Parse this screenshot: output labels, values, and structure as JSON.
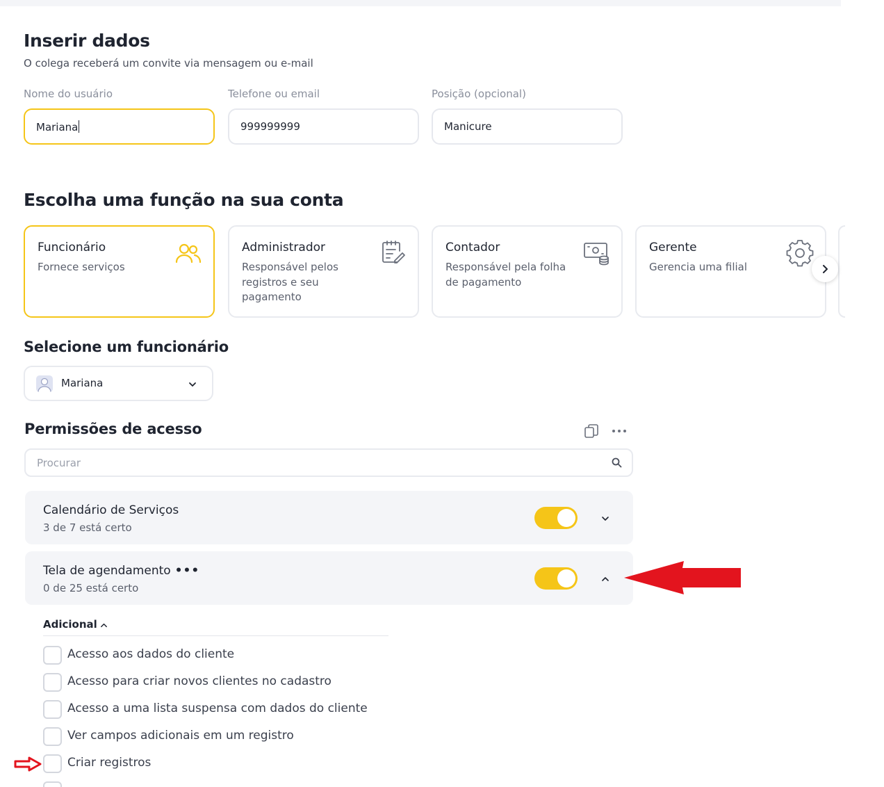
{
  "form": {
    "title": "Inserir dados",
    "subtitle": "O colega receberá um convite via mensagem ou e-mail",
    "fields": [
      {
        "label": "Nome do usuário",
        "value": "Mariana"
      },
      {
        "label": "Telefone ou email",
        "value": "999999999"
      },
      {
        "label": "Posição (opcional)",
        "value": "Manicure"
      }
    ]
  },
  "roles": {
    "title": "Escolha uma função na sua conta",
    "items": [
      {
        "title": "Funcionário",
        "desc": "Fornece serviços",
        "icon": "users-icon"
      },
      {
        "title": "Administrador",
        "desc": "Responsável pelos registros e seu pagamento",
        "icon": "clipboard-edit-icon"
      },
      {
        "title": "Contador",
        "desc": "Responsável pela folha de pagamento",
        "icon": "money-coins-icon"
      },
      {
        "title": "Gerente",
        "desc": "Gerencia uma filial",
        "icon": "gear-icon"
      }
    ]
  },
  "employee": {
    "title": "Selecione um funcionário",
    "selected": "Mariana"
  },
  "permissions": {
    "title": "Permissões de acesso",
    "search_placeholder": "Procurar",
    "sections": [
      {
        "title": "Calendário de Serviços",
        "count": "3 de 7 está certo",
        "enabled": true
      },
      {
        "title": "Tela de agendamento",
        "dots": "•••",
        "count": "0 de 25 está certo",
        "enabled": true
      }
    ],
    "additional": {
      "label": "Adicional",
      "items": [
        "Acesso aos dados do cliente",
        "Acesso para criar novos clientes no cadastro",
        "Acesso a uma lista suspensa com dados do cliente",
        "Ver campos adicionais em um registro",
        "Criar registros"
      ]
    }
  },
  "colors": {
    "accent": "#f5c518",
    "annotation": "#e3141e"
  }
}
